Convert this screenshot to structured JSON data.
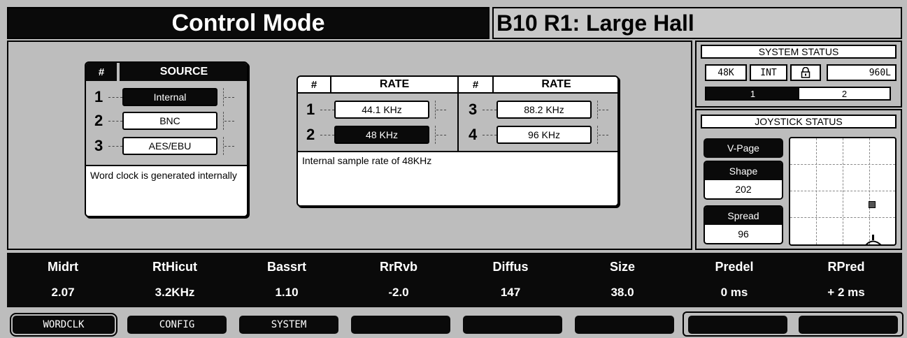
{
  "header": {
    "mode_title": "Control Mode",
    "program_title": "B10 R1: Large Hall"
  },
  "source": {
    "hash_label": "#",
    "header": "SOURCE",
    "items": [
      {
        "num": "1",
        "label": "Internal",
        "selected": true
      },
      {
        "num": "2",
        "label": "BNC",
        "selected": false
      },
      {
        "num": "3",
        "label": "AES/EBU",
        "selected": false
      }
    ],
    "description": "Word clock is generated internally"
  },
  "rate": {
    "hash_label": "#",
    "header": "RATE",
    "items": [
      {
        "num": "1",
        "label": "44.1 KHz",
        "selected": false
      },
      {
        "num": "2",
        "label": "48 KHz",
        "selected": true
      },
      {
        "num": "3",
        "label": "88.2 KHz",
        "selected": false
      },
      {
        "num": "4",
        "label": "96 KHz",
        "selected": false
      }
    ],
    "description": "Internal sample rate of 48KHz"
  },
  "system_status": {
    "title": "SYSTEM STATUS",
    "rate": "48K",
    "clock": "INT",
    "lock_icon": "lock-icon",
    "model": "960L",
    "machines": [
      "1",
      "2"
    ],
    "active_machine": "1"
  },
  "joystick_status": {
    "title": "JOYSTICK STATUS",
    "vpage": "V-Page",
    "shape_label": "Shape",
    "shape_value": "202",
    "spread_label": "Spread",
    "spread_value": "96"
  },
  "params": [
    {
      "name": "Midrt",
      "value": "2.07"
    },
    {
      "name": "RtHicut",
      "value": "3.2KHz"
    },
    {
      "name": "Bassrt",
      "value": "1.10"
    },
    {
      "name": "RrRvb",
      "value": "-2.0"
    },
    {
      "name": "Diffus",
      "value": "147"
    },
    {
      "name": "Size",
      "value": "38.0"
    },
    {
      "name": "Predel",
      "value": "0 ms"
    },
    {
      "name": "RPred",
      "value": "+ 2 ms"
    }
  ],
  "softkeys": [
    "WORDCLK",
    "CONFIG",
    "SYSTEM",
    "",
    "",
    "",
    "",
    ""
  ],
  "colors": {
    "background": "#bdbdbd",
    "dark": "#0a0a0a",
    "light": "#ffffff"
  }
}
